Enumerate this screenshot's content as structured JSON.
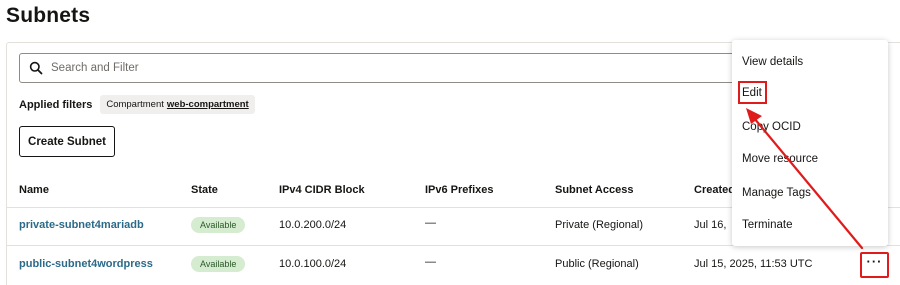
{
  "page": {
    "title": "Subnets"
  },
  "search": {
    "placeholder": "Search and Filter"
  },
  "filters": {
    "label": "Applied filters",
    "chip_key": "Compartment",
    "chip_value": "web-compartment"
  },
  "toolbar": {
    "create_label": "Create Subnet"
  },
  "table": {
    "columns": [
      "Name",
      "State",
      "IPv4 CIDR Block",
      "IPv6 Prefixes",
      "Subnet Access",
      "Created"
    ],
    "rows": [
      {
        "name": "private-subnet4mariadb",
        "state": "Available",
        "ipv4": "10.0.200.0/24",
        "ipv6": "—",
        "access": "Private (Regional)",
        "created": "Jul 16,"
      },
      {
        "name": "public-subnet4wordpress",
        "state": "Available",
        "ipv4": "10.0.100.0/24",
        "ipv6": "—",
        "access": "Public (Regional)",
        "created": "Jul 15, 2025, 11:53 UTC"
      }
    ]
  },
  "row_actions": {
    "label": "···"
  },
  "menu": {
    "items": [
      "View details",
      "Edit",
      "Copy OCID",
      "Move resource",
      "Manage Tags",
      "Terminate"
    ]
  },
  "colors": {
    "highlight": "#e01b1b",
    "link": "#2b6a89",
    "badge_bg": "#d5ecd0"
  }
}
